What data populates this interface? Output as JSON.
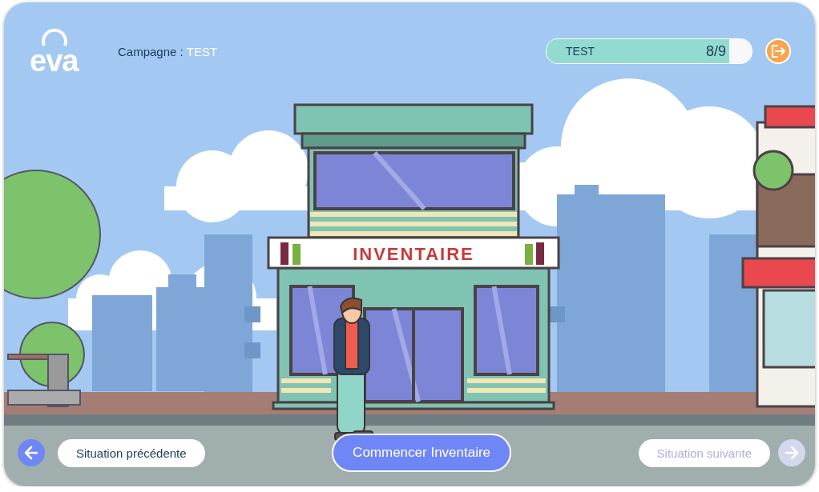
{
  "logo": {
    "text": "eva"
  },
  "campaign": {
    "label": "Campagne :",
    "value": "TEST"
  },
  "progress": {
    "label": "TEST",
    "count": "8/9",
    "level": 0.89
  },
  "scene": {
    "sign": "INVENTAIRE"
  },
  "footer": {
    "previous": {
      "label": "Situation précédente",
      "disabled": false
    },
    "start": {
      "label": "Commencer Inventaire"
    },
    "next": {
      "label": "Situation suivante",
      "disabled": true
    }
  }
}
